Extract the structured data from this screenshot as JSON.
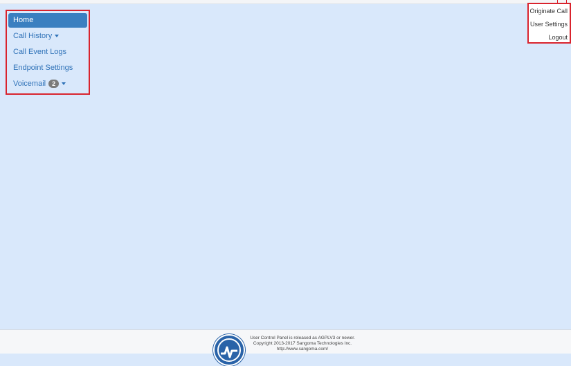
{
  "nav": {
    "items": [
      {
        "label": "Home"
      },
      {
        "label": "Call History"
      },
      {
        "label": "Call Event Logs"
      },
      {
        "label": "Endpoint Settings"
      },
      {
        "label": "Voicemail",
        "badge": "2"
      }
    ]
  },
  "user_menu": {
    "items": [
      {
        "label": "Originate Call"
      },
      {
        "label": "User Settings"
      },
      {
        "label": "Logout"
      }
    ]
  },
  "footer": {
    "line1": "User Control Panel is released as AGPLV3 or newer.",
    "line2": "Copyright 2013-2017 Sangoma Technologies Inc.",
    "line3": "http://www.sangoma.com/"
  },
  "colors": {
    "background": "#d9e8fb",
    "active": "#3a7fc0",
    "link": "#2f72b8",
    "highlight_border": "#d9232d"
  }
}
